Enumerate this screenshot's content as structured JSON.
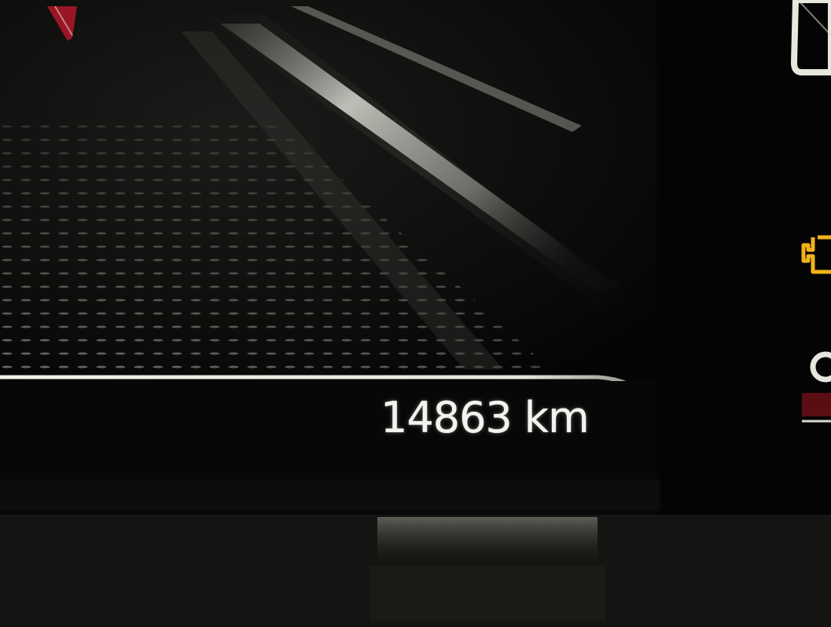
{
  "cluster": {
    "odometer": {
      "value": "14863",
      "unit": "km"
    },
    "warning_light": {
      "icon": "check-engine-icon",
      "color": "#f2b21a",
      "state": "lit"
    },
    "colors": {
      "background": "#000000",
      "text": "#f4f4ee",
      "divider": "#e8e8e0",
      "accent_red": "#b01828"
    }
  }
}
